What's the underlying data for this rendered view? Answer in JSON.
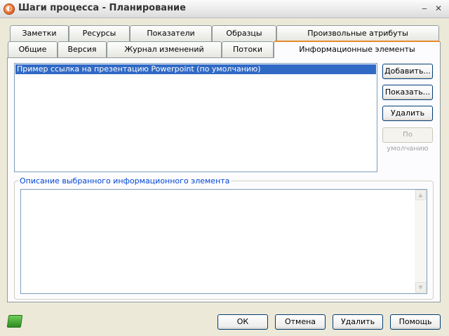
{
  "window": {
    "title": "Шаги процесса - Планирование",
    "icon": "app-icon"
  },
  "tabs_row1": [
    "Заметки",
    "Ресурсы",
    "Показатели",
    "Образцы",
    "Произвольные атрибуты"
  ],
  "tabs_row2": [
    "Общие",
    "Версия",
    "Журнал изменений",
    "Потоки",
    "Информационные элементы"
  ],
  "active_tab": "Информационные элементы",
  "list": {
    "items": [
      "Пример ссылка на презентацию Powerpoint  (по умолчанию)"
    ]
  },
  "side_buttons": {
    "add": "Добавить...",
    "show": "Показать...",
    "delete": "Удалить",
    "default": "По умолчанию"
  },
  "description": {
    "label": "Описание выбранного информационного элемента",
    "value": ""
  },
  "footer": {
    "ok": "ОК",
    "cancel": "Отмена",
    "delete": "Удалить",
    "help": "Помощь"
  },
  "colors": {
    "accent": "#e68b2c",
    "selection": "#316ac5",
    "group_label": "#0046d5"
  }
}
